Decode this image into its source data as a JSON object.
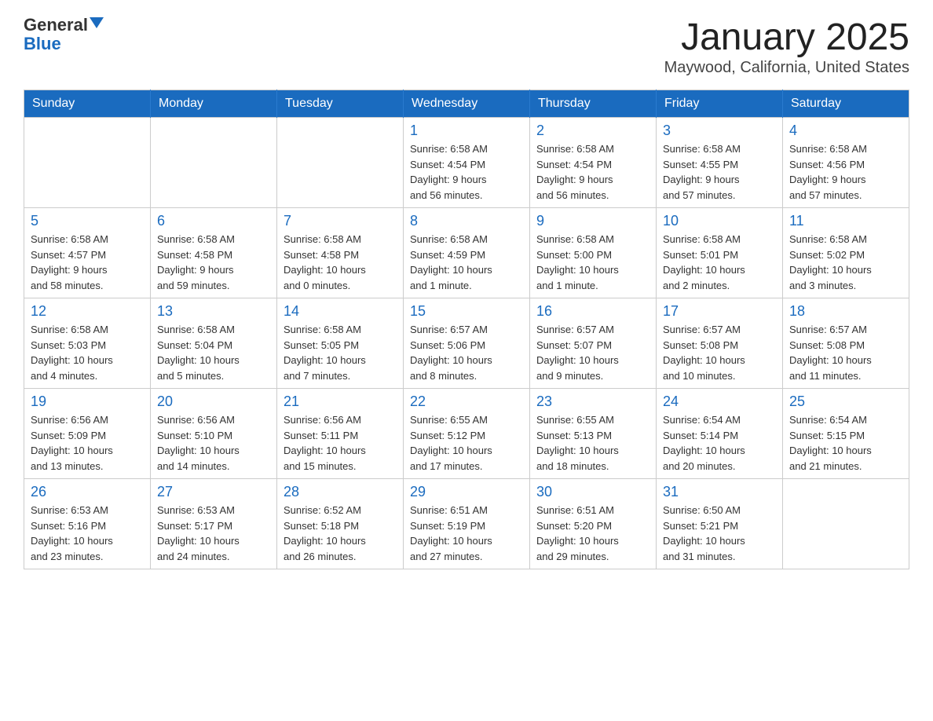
{
  "header": {
    "logo_general": "General",
    "logo_blue": "Blue",
    "title": "January 2025",
    "subtitle": "Maywood, California, United States"
  },
  "days_of_week": [
    "Sunday",
    "Monday",
    "Tuesday",
    "Wednesday",
    "Thursday",
    "Friday",
    "Saturday"
  ],
  "weeks": [
    [
      {
        "day": "",
        "info": ""
      },
      {
        "day": "",
        "info": ""
      },
      {
        "day": "",
        "info": ""
      },
      {
        "day": "1",
        "info": "Sunrise: 6:58 AM\nSunset: 4:54 PM\nDaylight: 9 hours\nand 56 minutes."
      },
      {
        "day": "2",
        "info": "Sunrise: 6:58 AM\nSunset: 4:54 PM\nDaylight: 9 hours\nand 56 minutes."
      },
      {
        "day": "3",
        "info": "Sunrise: 6:58 AM\nSunset: 4:55 PM\nDaylight: 9 hours\nand 57 minutes."
      },
      {
        "day": "4",
        "info": "Sunrise: 6:58 AM\nSunset: 4:56 PM\nDaylight: 9 hours\nand 57 minutes."
      }
    ],
    [
      {
        "day": "5",
        "info": "Sunrise: 6:58 AM\nSunset: 4:57 PM\nDaylight: 9 hours\nand 58 minutes."
      },
      {
        "day": "6",
        "info": "Sunrise: 6:58 AM\nSunset: 4:58 PM\nDaylight: 9 hours\nand 59 minutes."
      },
      {
        "day": "7",
        "info": "Sunrise: 6:58 AM\nSunset: 4:58 PM\nDaylight: 10 hours\nand 0 minutes."
      },
      {
        "day": "8",
        "info": "Sunrise: 6:58 AM\nSunset: 4:59 PM\nDaylight: 10 hours\nand 1 minute."
      },
      {
        "day": "9",
        "info": "Sunrise: 6:58 AM\nSunset: 5:00 PM\nDaylight: 10 hours\nand 1 minute."
      },
      {
        "day": "10",
        "info": "Sunrise: 6:58 AM\nSunset: 5:01 PM\nDaylight: 10 hours\nand 2 minutes."
      },
      {
        "day": "11",
        "info": "Sunrise: 6:58 AM\nSunset: 5:02 PM\nDaylight: 10 hours\nand 3 minutes."
      }
    ],
    [
      {
        "day": "12",
        "info": "Sunrise: 6:58 AM\nSunset: 5:03 PM\nDaylight: 10 hours\nand 4 minutes."
      },
      {
        "day": "13",
        "info": "Sunrise: 6:58 AM\nSunset: 5:04 PM\nDaylight: 10 hours\nand 5 minutes."
      },
      {
        "day": "14",
        "info": "Sunrise: 6:58 AM\nSunset: 5:05 PM\nDaylight: 10 hours\nand 7 minutes."
      },
      {
        "day": "15",
        "info": "Sunrise: 6:57 AM\nSunset: 5:06 PM\nDaylight: 10 hours\nand 8 minutes."
      },
      {
        "day": "16",
        "info": "Sunrise: 6:57 AM\nSunset: 5:07 PM\nDaylight: 10 hours\nand 9 minutes."
      },
      {
        "day": "17",
        "info": "Sunrise: 6:57 AM\nSunset: 5:08 PM\nDaylight: 10 hours\nand 10 minutes."
      },
      {
        "day": "18",
        "info": "Sunrise: 6:57 AM\nSunset: 5:08 PM\nDaylight: 10 hours\nand 11 minutes."
      }
    ],
    [
      {
        "day": "19",
        "info": "Sunrise: 6:56 AM\nSunset: 5:09 PM\nDaylight: 10 hours\nand 13 minutes."
      },
      {
        "day": "20",
        "info": "Sunrise: 6:56 AM\nSunset: 5:10 PM\nDaylight: 10 hours\nand 14 minutes."
      },
      {
        "day": "21",
        "info": "Sunrise: 6:56 AM\nSunset: 5:11 PM\nDaylight: 10 hours\nand 15 minutes."
      },
      {
        "day": "22",
        "info": "Sunrise: 6:55 AM\nSunset: 5:12 PM\nDaylight: 10 hours\nand 17 minutes."
      },
      {
        "day": "23",
        "info": "Sunrise: 6:55 AM\nSunset: 5:13 PM\nDaylight: 10 hours\nand 18 minutes."
      },
      {
        "day": "24",
        "info": "Sunrise: 6:54 AM\nSunset: 5:14 PM\nDaylight: 10 hours\nand 20 minutes."
      },
      {
        "day": "25",
        "info": "Sunrise: 6:54 AM\nSunset: 5:15 PM\nDaylight: 10 hours\nand 21 minutes."
      }
    ],
    [
      {
        "day": "26",
        "info": "Sunrise: 6:53 AM\nSunset: 5:16 PM\nDaylight: 10 hours\nand 23 minutes."
      },
      {
        "day": "27",
        "info": "Sunrise: 6:53 AM\nSunset: 5:17 PM\nDaylight: 10 hours\nand 24 minutes."
      },
      {
        "day": "28",
        "info": "Sunrise: 6:52 AM\nSunset: 5:18 PM\nDaylight: 10 hours\nand 26 minutes."
      },
      {
        "day": "29",
        "info": "Sunrise: 6:51 AM\nSunset: 5:19 PM\nDaylight: 10 hours\nand 27 minutes."
      },
      {
        "day": "30",
        "info": "Sunrise: 6:51 AM\nSunset: 5:20 PM\nDaylight: 10 hours\nand 29 minutes."
      },
      {
        "day": "31",
        "info": "Sunrise: 6:50 AM\nSunset: 5:21 PM\nDaylight: 10 hours\nand 31 minutes."
      },
      {
        "day": "",
        "info": ""
      }
    ]
  ]
}
